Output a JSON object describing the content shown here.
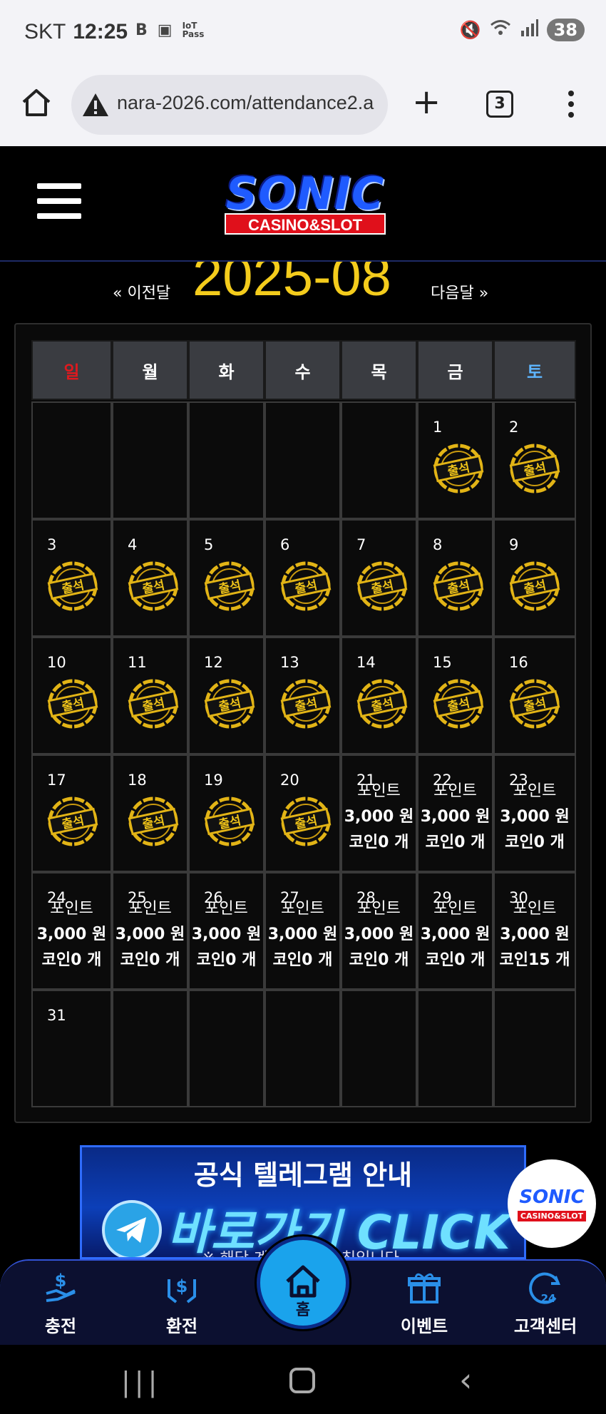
{
  "status_bar": {
    "carrier": "SKT",
    "time": "12:25",
    "icon_b": "B",
    "iot_label": "IoT\nPass",
    "battery": "38"
  },
  "browser": {
    "url": "nara-2026.com/attendance2.a",
    "tab_count": "3"
  },
  "logo": {
    "title": "SONIC",
    "subtitle": "CASINO&SLOT"
  },
  "month_nav": {
    "prev_label": "« 이전달",
    "title": "2025-08",
    "next_label": "다음달 »"
  },
  "calendar": {
    "weekdays": [
      "일",
      "월",
      "화",
      "수",
      "목",
      "금",
      "토"
    ],
    "stamp_text": "출석",
    "point_label": "포인트",
    "weeks": [
      [
        null,
        null,
        null,
        null,
        null,
        {
          "day": "1",
          "stamp": true
        },
        {
          "day": "2",
          "stamp": true
        }
      ],
      [
        {
          "day": "3",
          "stamp": true
        },
        {
          "day": "4",
          "stamp": true
        },
        {
          "day": "5",
          "stamp": true
        },
        {
          "day": "6",
          "stamp": true
        },
        {
          "day": "7",
          "stamp": true
        },
        {
          "day": "8",
          "stamp": true
        },
        {
          "day": "9",
          "stamp": true
        }
      ],
      [
        {
          "day": "10",
          "stamp": true
        },
        {
          "day": "11",
          "stamp": true
        },
        {
          "day": "12",
          "stamp": true
        },
        {
          "day": "13",
          "stamp": true
        },
        {
          "day": "14",
          "stamp": true
        },
        {
          "day": "15",
          "stamp": true
        },
        {
          "day": "16",
          "stamp": true
        }
      ],
      [
        {
          "day": "17",
          "stamp": true
        },
        {
          "day": "18",
          "stamp": true
        },
        {
          "day": "19",
          "stamp": true
        },
        {
          "day": "20",
          "stamp": true
        },
        {
          "day": "21",
          "point": "3,000 원",
          "coin": "코인0 개"
        },
        {
          "day": "22",
          "point": "3,000 원",
          "coin": "코인0 개"
        },
        {
          "day": "23",
          "point": "3,000 원",
          "coin": "코인0 개"
        }
      ],
      [
        {
          "day": "24",
          "point": "3,000 원",
          "coin": "코인0 개"
        },
        {
          "day": "25",
          "point": "3,000 원",
          "coin": "코인0 개"
        },
        {
          "day": "26",
          "point": "3,000 원",
          "coin": "코인0 개"
        },
        {
          "day": "27",
          "point": "3,000 원",
          "coin": "코인0 개"
        },
        {
          "day": "28",
          "point": "3,000 원",
          "coin": "코인0 개"
        },
        {
          "day": "29",
          "point": "3,000 원",
          "coin": "코인0 개"
        },
        {
          "day": "30",
          "point": "3,000 원",
          "coin": "코인15 개"
        }
      ],
      [
        {
          "day": "31"
        },
        null,
        null,
        null,
        null,
        null,
        null
      ]
    ]
  },
  "banner": {
    "title": "공식 텔레그램 안내",
    "cta": "바로가기 CLICK",
    "note": "※ 해당 계정 외 ... 사칭입니다."
  },
  "float_logo": {
    "title": "SONIC",
    "subtitle": "CASINO&SLOT"
  },
  "bottom_nav": {
    "deposit": "충전",
    "withdraw": "환전",
    "home": "홈",
    "event": "이벤트",
    "support": "고객센터"
  },
  "colors": {
    "accent_gold": "#f4cc1c",
    "sunday_red": "#e0191e",
    "saturday_blue": "#5eb6ff",
    "nav_blue": "#1aa3ec"
  }
}
